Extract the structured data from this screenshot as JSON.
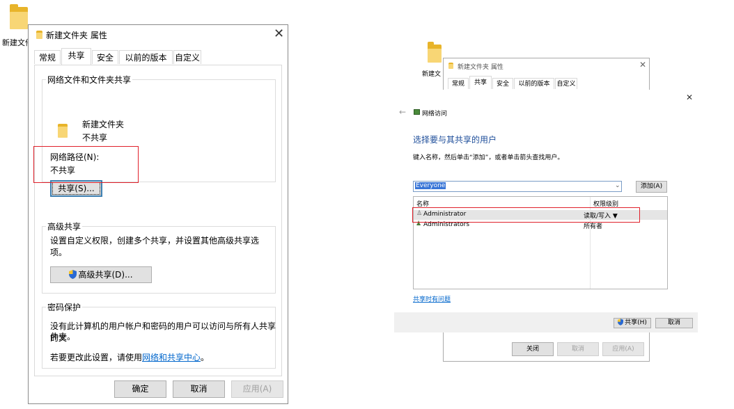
{
  "desktop_left": {
    "folder_label": "新建文件"
  },
  "props_dialog": {
    "title": "新建文件夹 属性",
    "tabs": [
      "常规",
      "共享",
      "安全",
      "以前的版本",
      "自定义"
    ],
    "active_tab": "共享",
    "net_share": {
      "group_label": "网络文件和文件夹共享",
      "folder_name": "新建文件夹",
      "share_state": "不共享",
      "path_label": "网络路径(N):",
      "path_value": "不共享",
      "share_button": "共享(S)..."
    },
    "advanced": {
      "group_label": "高级共享",
      "desc": "设置自定义权限，创建多个共享，并设置其他高级共享选项。",
      "button": "高级共享(D)..."
    },
    "password": {
      "group_label": "密码保护",
      "desc_line1": "没有此计算机的用户帐户和密码的用户可以访问与所有人共享的文",
      "desc_line2": "件夹。",
      "change_prefix": "若要更改此设置，请使用",
      "change_link": "网络和共享中心",
      "change_suffix": "。"
    },
    "footer": {
      "ok": "确定",
      "cancel": "取消",
      "apply": "应用(A)"
    }
  },
  "desktop_right": {
    "folder_label": "新建文"
  },
  "bg_dialog": {
    "title": "新建文件夹 属性",
    "tabs": [
      "常规",
      "共享",
      "安全",
      "以前的版本",
      "自定义"
    ],
    "footer": {
      "close": "关闭",
      "cancel": "取消",
      "apply": "应用(A)"
    }
  },
  "net_access": {
    "window_title": "网络访问",
    "heading": "选择要与其共享的用户",
    "instruction": "键入名称，然后单击“添加”，或者单击箭头查找用户。",
    "combo_value": "Everyone",
    "add_button": "添加(A)",
    "columns": {
      "name": "名称",
      "level": "权限级别"
    },
    "rows": [
      {
        "name": "Administrator",
        "level": "读取/写入 ▼"
      },
      {
        "name": "Administrators",
        "level": "所有者"
      }
    ],
    "trouble_link": "共享时有问题",
    "share_button": "共享(H)",
    "cancel_button": "取消"
  },
  "colors": {
    "accent": "#0066cc",
    "highlight": "#e0202a",
    "heading": "#1e4e9a"
  }
}
